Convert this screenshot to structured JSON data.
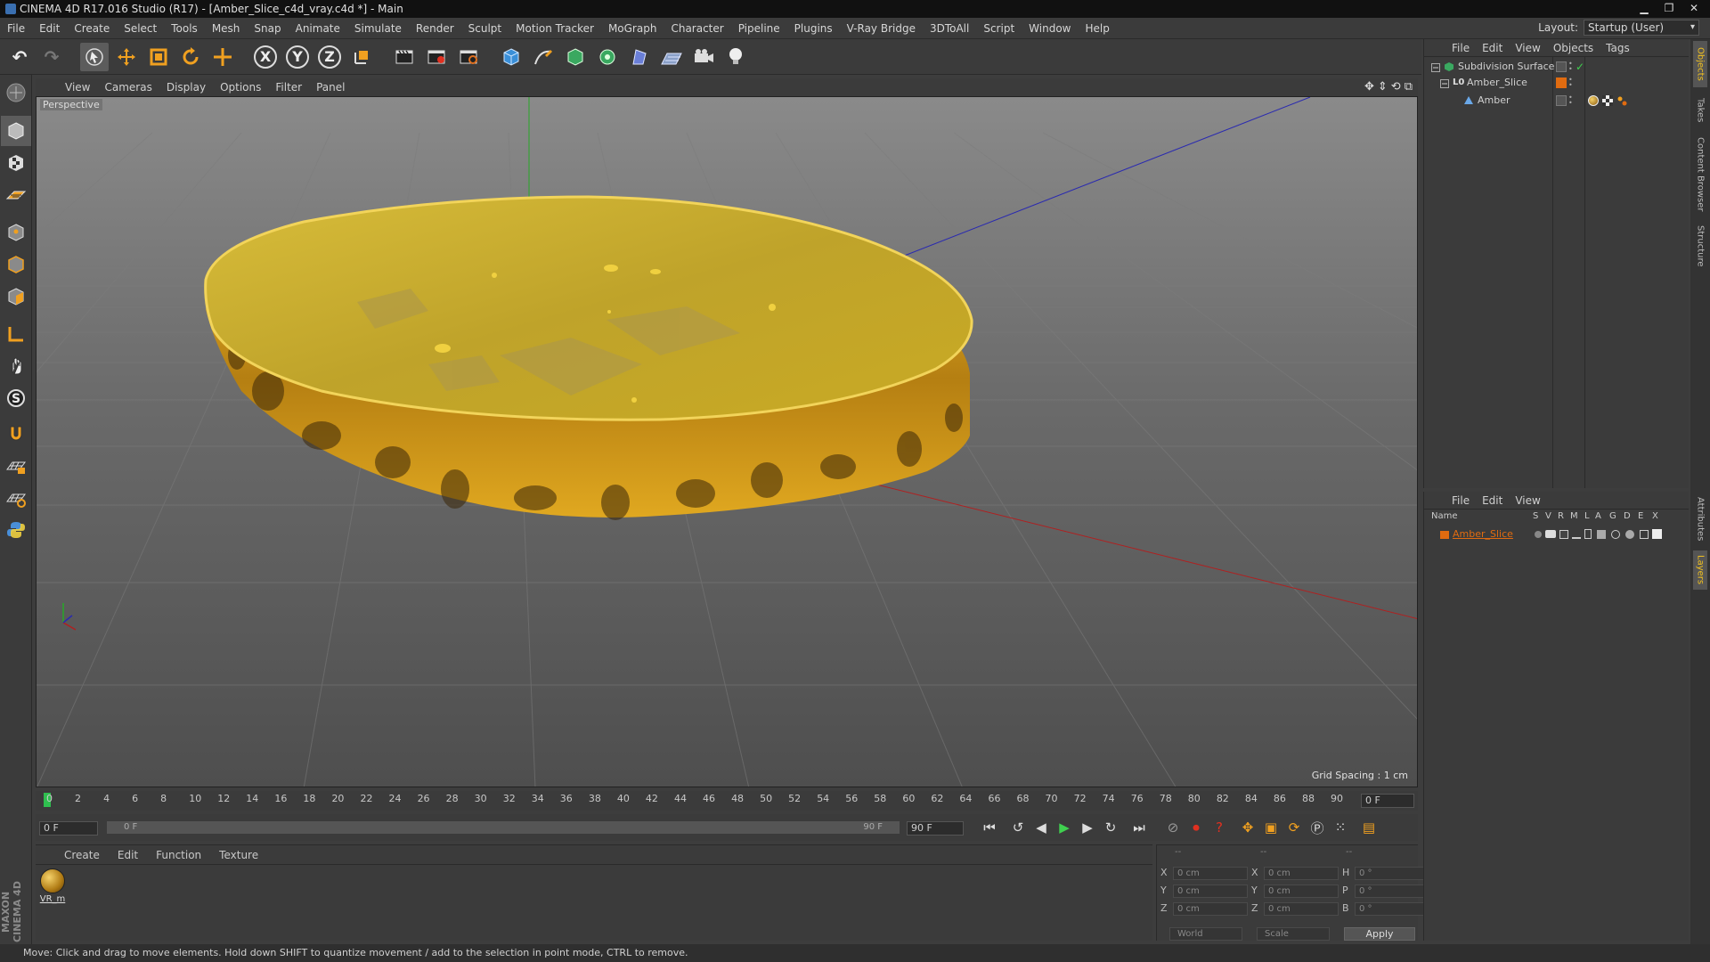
{
  "window": {
    "title": "CINEMA 4D R17.016 Studio (R17) - [Amber_Slice_c4d_vray.c4d *] - Main",
    "minimize": "▁",
    "maximize": "❐",
    "close": "✕"
  },
  "menu": [
    "File",
    "Edit",
    "Create",
    "Select",
    "Tools",
    "Mesh",
    "Snap",
    "Animate",
    "Simulate",
    "Render",
    "Sculpt",
    "Motion Tracker",
    "MoGraph",
    "Character",
    "Pipeline",
    "Plugins",
    "V-Ray Bridge",
    "3DToAll",
    "Script",
    "Window",
    "Help"
  ],
  "layout": {
    "label": "Layout:",
    "value": "Startup (User)"
  },
  "toolbar": {
    "undo": "↶",
    "redo": "↷",
    "axis_x": "X",
    "axis_y": "Y",
    "axis_z": "Z"
  },
  "viewport": {
    "menu": [
      "View",
      "Cameras",
      "Display",
      "Options",
      "Filter",
      "Panel"
    ],
    "camera_label": "Perspective",
    "grid_spacing": "Grid Spacing : 1 cm",
    "nav_icons": [
      "✥",
      "⇕",
      "⟲",
      "⧉"
    ]
  },
  "timeline": {
    "ticks": [
      "0",
      "2",
      "4",
      "6",
      "8",
      "10",
      "12",
      "14",
      "16",
      "18",
      "20",
      "22",
      "24",
      "26",
      "28",
      "30",
      "32",
      "34",
      "36",
      "38",
      "40",
      "42",
      "44",
      "46",
      "48",
      "50",
      "52",
      "54",
      "56",
      "58",
      "60",
      "62",
      "64",
      "66",
      "68",
      "70",
      "72",
      "74",
      "76",
      "78",
      "80",
      "82",
      "84",
      "86",
      "88",
      "90"
    ],
    "current_frame": "0 F",
    "frame_end_field": "0 F"
  },
  "playback": {
    "start_field": "0 F",
    "slider_start": "0 F",
    "slider_end": "90 F",
    "end_field": "90 F",
    "current_fraction": 0.0
  },
  "material_manager": {
    "menu": [
      "Create",
      "Edit",
      "Function",
      "Texture"
    ],
    "material_name": "VR_m"
  },
  "coordinates": {
    "header_left": "--",
    "header_mid": "--",
    "header_right": "--",
    "rows": [
      {
        "a1": "X",
        "v1": "0 cm",
        "a2": "X",
        "v2": "0 cm",
        "a3": "H",
        "v3": "0 °"
      },
      {
        "a1": "Y",
        "v1": "0 cm",
        "a2": "Y",
        "v2": "0 cm",
        "a3": "P",
        "v3": "0 °"
      },
      {
        "a1": "Z",
        "v1": "0 cm",
        "a2": "Z",
        "v2": "0 cm",
        "a3": "B",
        "v3": "0 °"
      }
    ],
    "mode_world": "World",
    "mode_scale": "Scale",
    "apply": "Apply"
  },
  "object_manager": {
    "menu": [
      "File",
      "Edit",
      "View",
      "Objects",
      "Tags"
    ],
    "objects": [
      {
        "name": "Subdivision Surface"
      },
      {
        "name": "Amber_Slice"
      },
      {
        "name": "Amber"
      }
    ]
  },
  "layer_manager": {
    "menu": [
      "File",
      "Edit",
      "View"
    ],
    "columns": [
      "Name",
      "S",
      "V",
      "R",
      "M",
      "L",
      "A",
      "G",
      "D",
      "E",
      "X"
    ],
    "layer_name": "Amber_Slice"
  },
  "right_tabs": [
    "Objects",
    "Takes",
    "Content Browser",
    "Structure",
    "Attributes",
    "Layers"
  ],
  "status": "Move: Click and drag to move elements. Hold down SHIFT to quantize movement / add to the selection in point mode, CTRL to remove.",
  "maxon_logo": "MAXON CINEMA 4D",
  "colors": {
    "accent_orange": "#e06b10",
    "amber": "#d9a81a",
    "axis_green": "#27a827",
    "axis_red": "#b02020",
    "axis_blue": "#2a2ab0"
  }
}
